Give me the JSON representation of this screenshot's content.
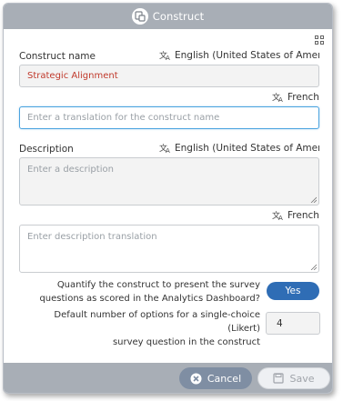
{
  "dialog": {
    "title": "Construct",
    "title_icon": "construct-icon",
    "layout_icon": "grid-icon"
  },
  "construct_name": {
    "label": "Construct name",
    "source_language": "English (United States of Amer…",
    "value": "Strategic Alignment",
    "translation_language": "French",
    "translation_placeholder": "Enter a translation for the construct name",
    "translation_value": ""
  },
  "description": {
    "label": "Description",
    "source_language": "English (United States of Amer…",
    "placeholder": "Enter a description",
    "translation_language": "French",
    "translation_placeholder": "Enter description translation"
  },
  "quantify": {
    "line1": "Quantify the construct to present the survey",
    "line2": "questions as scored in the Analytics Dashboard?",
    "toggle_label": "Yes"
  },
  "likert": {
    "line1": "Default number of options for a single-choice (Likert)",
    "line2": "survey question in the construct",
    "value": "4"
  },
  "footer": {
    "cancel_label": "Cancel",
    "save_label": "Save"
  },
  "colors": {
    "header_bar": "#a8aeb6",
    "toggle_on": "#2f6db5",
    "name_value": "#c0392b",
    "focus_border": "#4aa3df"
  }
}
